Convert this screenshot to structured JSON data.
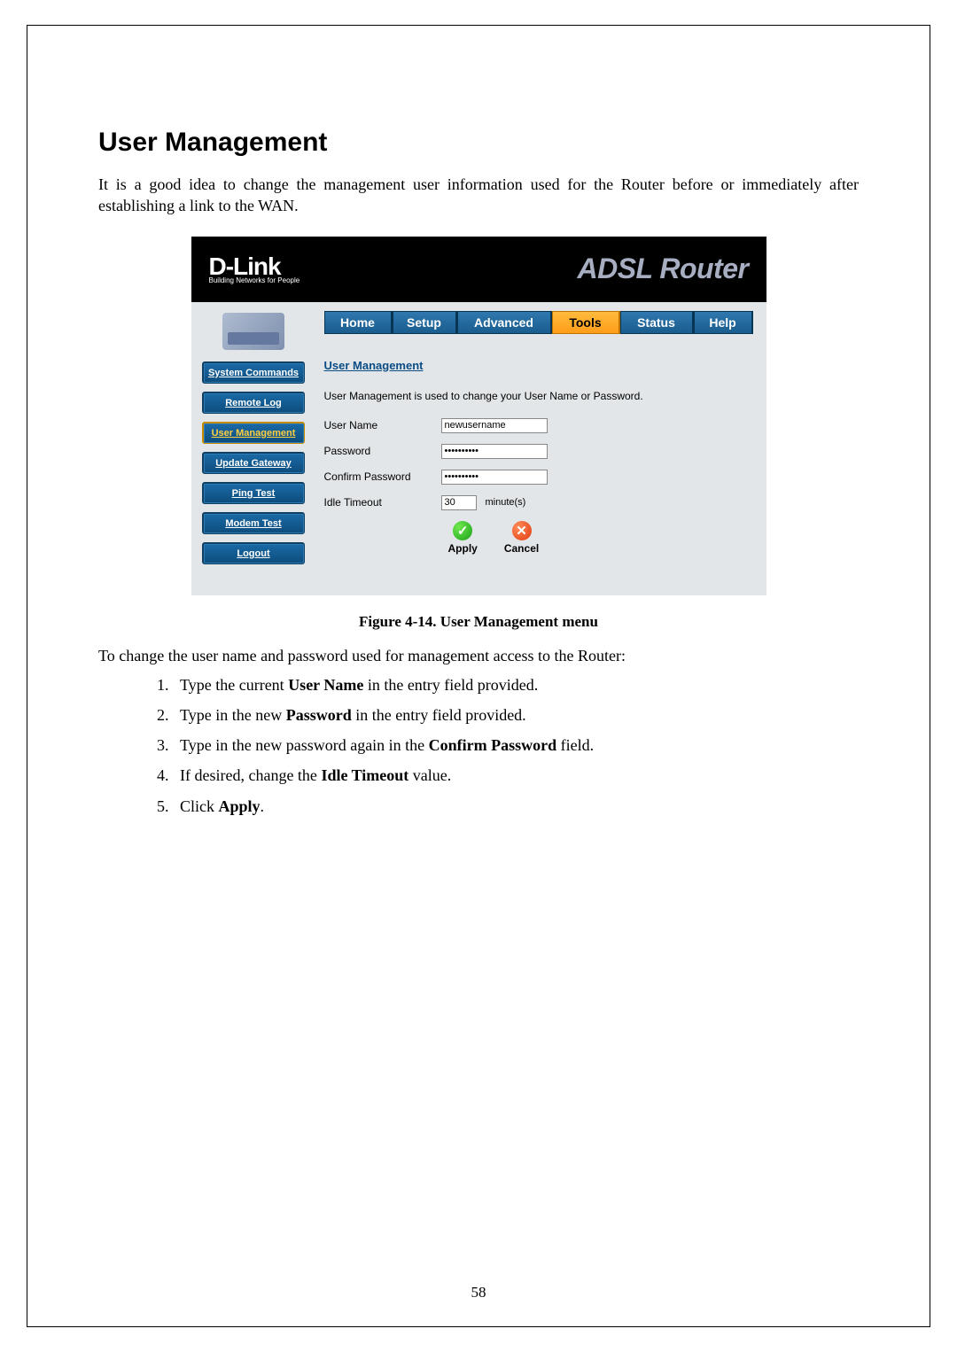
{
  "doc": {
    "title": "User Management",
    "intro": "It is a good idea to change the management user information used for the Router before or immediately after establishing a link to the WAN.",
    "caption": "Figure 4-14. User Management menu",
    "after": "To change the user name and password used for management access to the Router:",
    "steps": [
      {
        "pre": "Type the current ",
        "b": "User Name",
        "post": " in the entry field provided."
      },
      {
        "pre": "Type in the new ",
        "b": "Password",
        "post": " in the entry field provided."
      },
      {
        "pre": "Type in the new password again in the ",
        "b": "Confirm Password",
        "post": " field."
      },
      {
        "pre": "If desired, change the ",
        "b": "Idle Timeout",
        "post": " value."
      },
      {
        "pre": "Click ",
        "b": "Apply",
        "post": "."
      }
    ],
    "page_number": "58"
  },
  "router": {
    "brand_main": "D-Link",
    "brand_tag": "Building Networks for People",
    "product": "ADSL Router",
    "tabs": {
      "home": "Home",
      "setup": "Setup",
      "advanced": "Advanced",
      "tools": "Tools",
      "status": "Status",
      "help": "Help",
      "active": "tools"
    },
    "sidebar": {
      "items": [
        {
          "label": "System Commands",
          "active": false
        },
        {
          "label": "Remote Log",
          "active": false
        },
        {
          "label": "User Management",
          "active": true
        },
        {
          "label": "Update Gateway",
          "active": false
        },
        {
          "label": "Ping Test",
          "active": false
        },
        {
          "label": "Modem Test",
          "active": false
        },
        {
          "label": "Logout",
          "active": false
        }
      ]
    },
    "panel": {
      "title": "User Management",
      "desc": "User Management is used to change your User Name or Password.",
      "fields": {
        "username_label": "User Name",
        "username_value": "newusername",
        "password_label": "Password",
        "password_value": "••••••••••",
        "confirm_label": "Confirm Password",
        "confirm_value": "••••••••••",
        "timeout_label": "Idle Timeout",
        "timeout_value": "30",
        "timeout_unit": "minute(s)"
      },
      "buttons": {
        "apply": "Apply",
        "cancel": "Cancel"
      }
    }
  }
}
